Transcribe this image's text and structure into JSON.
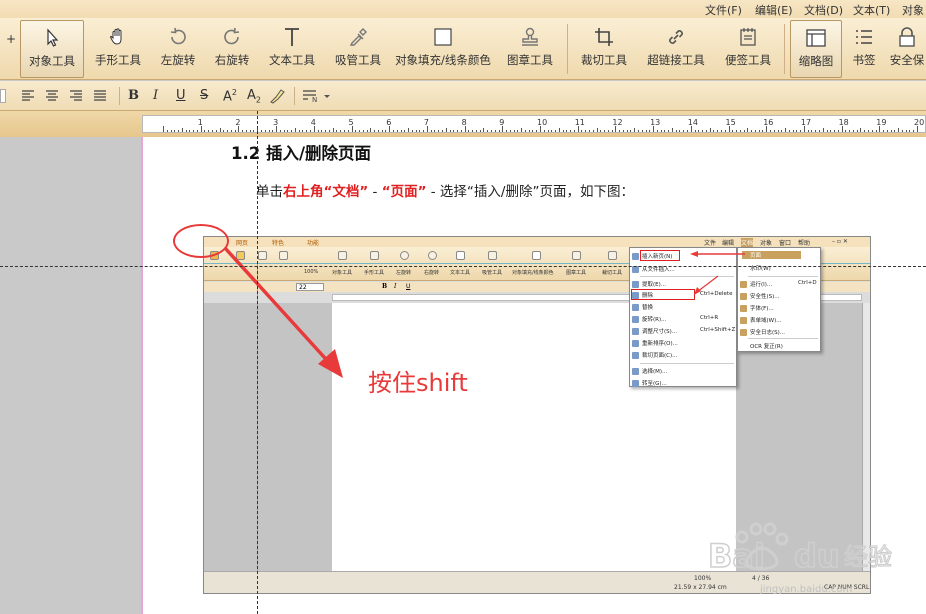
{
  "menubar": {
    "items": [
      "文件(F)",
      "编辑(E)",
      "文档(D)",
      "文本(T)",
      "对象"
    ]
  },
  "toolbar": {
    "plus": "+",
    "tools": [
      {
        "label": "对象工具",
        "icon": "cursor-arrow-icon"
      },
      {
        "label": "手形工具",
        "icon": "hand-icon"
      },
      {
        "label": "左旋转",
        "icon": "rotate-left-icon"
      },
      {
        "label": "右旋转",
        "icon": "rotate-right-icon"
      },
      {
        "label": "文本工具",
        "icon": "text-cursor-icon"
      },
      {
        "label": "吸管工具",
        "icon": "eyedropper-icon"
      },
      {
        "label": "对象填充/线条颜色",
        "icon": "fill-color-icon"
      },
      {
        "label": "图章工具",
        "icon": "stamp-icon"
      },
      {
        "label": "裁切工具",
        "icon": "crop-icon"
      },
      {
        "label": "超链接工具",
        "icon": "link-icon"
      },
      {
        "label": "便签工具",
        "icon": "sticky-note-icon"
      },
      {
        "label": "缩略图",
        "icon": "thumbnail-icon"
      },
      {
        "label": "书签",
        "icon": "bookmark-list-icon"
      },
      {
        "label": "安全保",
        "icon": "lock-icon"
      }
    ]
  },
  "format": {
    "bold": "B",
    "italic": "I",
    "underline": "U",
    "strike": "S",
    "superscript": "A",
    "subscript": "A",
    "list": "N"
  },
  "ruler": {
    "numbers": [
      "1",
      "2",
      "3",
      "4",
      "5",
      "6",
      "7",
      "8",
      "9",
      "10",
      "11",
      "12",
      "13",
      "14",
      "15",
      "16",
      "17",
      "18",
      "19",
      "20"
    ]
  },
  "doc": {
    "heading": "1.2 插入/删除页面",
    "para_prefix": "单击",
    "para_red1": "右上角“文档”",
    "para_dash1": " - ",
    "para_red2": "“页面”",
    "para_rest": " - 选择“插入/删除”页面，如下图："
  },
  "shot": {
    "menu": [
      "文件",
      "编辑",
      "文档",
      "对象",
      "窗口",
      "帮助"
    ],
    "tabs": [
      "网页",
      "特色",
      "功能"
    ],
    "tools": [
      "100%",
      "对象工具",
      "手形工具",
      "左旋转",
      "右旋转",
      "文本工具",
      "吸管工具",
      "对象填充/线条颜色",
      "图章工具",
      "裁切工具"
    ],
    "font_size": "22",
    "menu1": [
      {
        "label": "插入新页(N)",
        "shortcut": ""
      },
      {
        "label": "从文件插入...",
        "shortcut": ""
      },
      {
        "label": "提取(E)...",
        "shortcut": ""
      },
      {
        "label": "删除",
        "shortcut": "Ctrl+Delete"
      },
      {
        "label": "替换",
        "shortcut": ""
      },
      {
        "label": "旋转(R)...",
        "shortcut": "Ctrl+R"
      },
      {
        "label": "调整尺寸(S)...",
        "shortcut": "Ctrl+Shift+Z"
      },
      {
        "label": "重新排序(O)...",
        "shortcut": ""
      },
      {
        "label": "裁切页面(C)...",
        "shortcut": ""
      },
      {
        "label": "选择(M)...",
        "shortcut": ""
      },
      {
        "label": "转至(G)...",
        "shortcut": ""
      }
    ],
    "menu2": [
      {
        "label": "页面",
        "shortcut": ""
      },
      {
        "label": "水印(W)",
        "shortcut": ""
      },
      {
        "label": "运行(I)...",
        "shortcut": "Ctrl+D"
      },
      {
        "label": "安全性(S)...",
        "shortcut": ""
      },
      {
        "label": "字体(F)...",
        "shortcut": ""
      },
      {
        "label": "表单域(W)...",
        "shortcut": ""
      },
      {
        "label": "安全日志(S)...",
        "shortcut": ""
      },
      {
        "label": "OCR 复正(R)",
        "shortcut": ""
      }
    ],
    "status": {
      "zoom": "100%",
      "page": "4 / 36",
      "size": "21.59 x 27.94 cm",
      "mode": "CAP NUM SCRL"
    }
  },
  "annotation": {
    "text": "按住shift",
    "color": "#e83a3a"
  },
  "watermark": {
    "text": "jingyan.baidu.com"
  }
}
